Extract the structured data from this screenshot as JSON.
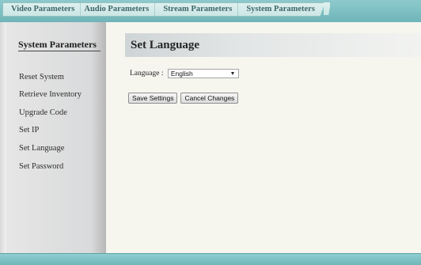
{
  "tabs": [
    {
      "label": "Video Parameters"
    },
    {
      "label": "Audio Parameters"
    },
    {
      "label": "Stream Parameters"
    },
    {
      "label": "System Parameters"
    }
  ],
  "sidebar": {
    "title": "System Parameters",
    "items": [
      {
        "label": "Reset System"
      },
      {
        "label": "Retrieve Inventory"
      },
      {
        "label": "Upgrade Code"
      },
      {
        "label": "Set IP"
      },
      {
        "label": "Set Language"
      },
      {
        "label": "Set Password"
      }
    ]
  },
  "main": {
    "title": "Set Language",
    "language_label": "Language : ",
    "language_value": "English",
    "save_label": "Save Settings",
    "cancel_label": "Cancel Changes"
  },
  "colors": {
    "tab_bar": "#7fc1c4",
    "tab_text": "#40666a",
    "sidebar_bg": "#dcdcdc",
    "page_bg": "#f6f6ef"
  }
}
